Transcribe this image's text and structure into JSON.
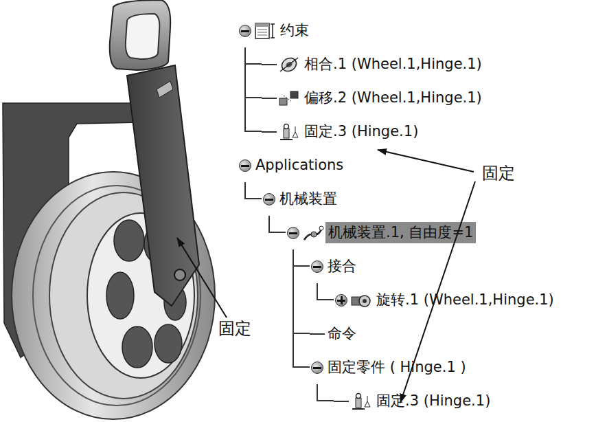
{
  "tree": [
    {
      "label": "约束",
      "kind": "constraint-set",
      "expandable": true,
      "expanded": true,
      "selected": false,
      "children": [
        {
          "label": "相合.1 (Wheel.1,Hinge.1)",
          "kind": "coincidence",
          "expandable": false,
          "expanded": false,
          "selected": false,
          "children": []
        },
        {
          "label": "偏移.2 (Wheel.1,Hinge.1)",
          "kind": "offset",
          "expandable": false,
          "expanded": false,
          "selected": false,
          "children": []
        },
        {
          "label": "固定.3 (Hinge.1)",
          "kind": "fix",
          "expandable": false,
          "expanded": false,
          "selected": false,
          "children": []
        }
      ]
    },
    {
      "label": "Applications",
      "kind": "group",
      "expandable": true,
      "expanded": true,
      "selected": false,
      "children": [
        {
          "label": "机械装置",
          "kind": "group",
          "expandable": true,
          "expanded": true,
          "selected": false,
          "children": [
            {
              "label": "机械装置.1, 自由度=1",
              "kind": "mechanism",
              "expandable": true,
              "expanded": true,
              "selected": true,
              "children": [
                {
                  "label": "接合",
                  "kind": "group",
                  "expandable": true,
                  "expanded": true,
                  "selected": false,
                  "children": [
                    {
                      "label": "旋转.1 (Wheel.1,Hinge.1)",
                      "kind": "joint",
                      "expandable": true,
                      "expanded": false,
                      "selected": false,
                      "children": []
                    }
                  ]
                },
                {
                  "label": "命令",
                  "kind": "group",
                  "expandable": false,
                  "expanded": false,
                  "selected": false,
                  "children": []
                },
                {
                  "label": "固定零件 ( Hinge.1 )",
                  "kind": "group",
                  "expandable": true,
                  "expanded": true,
                  "selected": false,
                  "children": [
                    {
                      "label": "固定.3 (Hinge.1)",
                      "kind": "fix",
                      "expandable": false,
                      "expanded": false,
                      "selected": false,
                      "children": []
                    }
                  ]
                }
              ]
            }
          ]
        }
      ]
    }
  ],
  "annotations": [
    {
      "label": "固定",
      "target": "tree"
    },
    {
      "label": "固定",
      "target": "model"
    }
  ]
}
